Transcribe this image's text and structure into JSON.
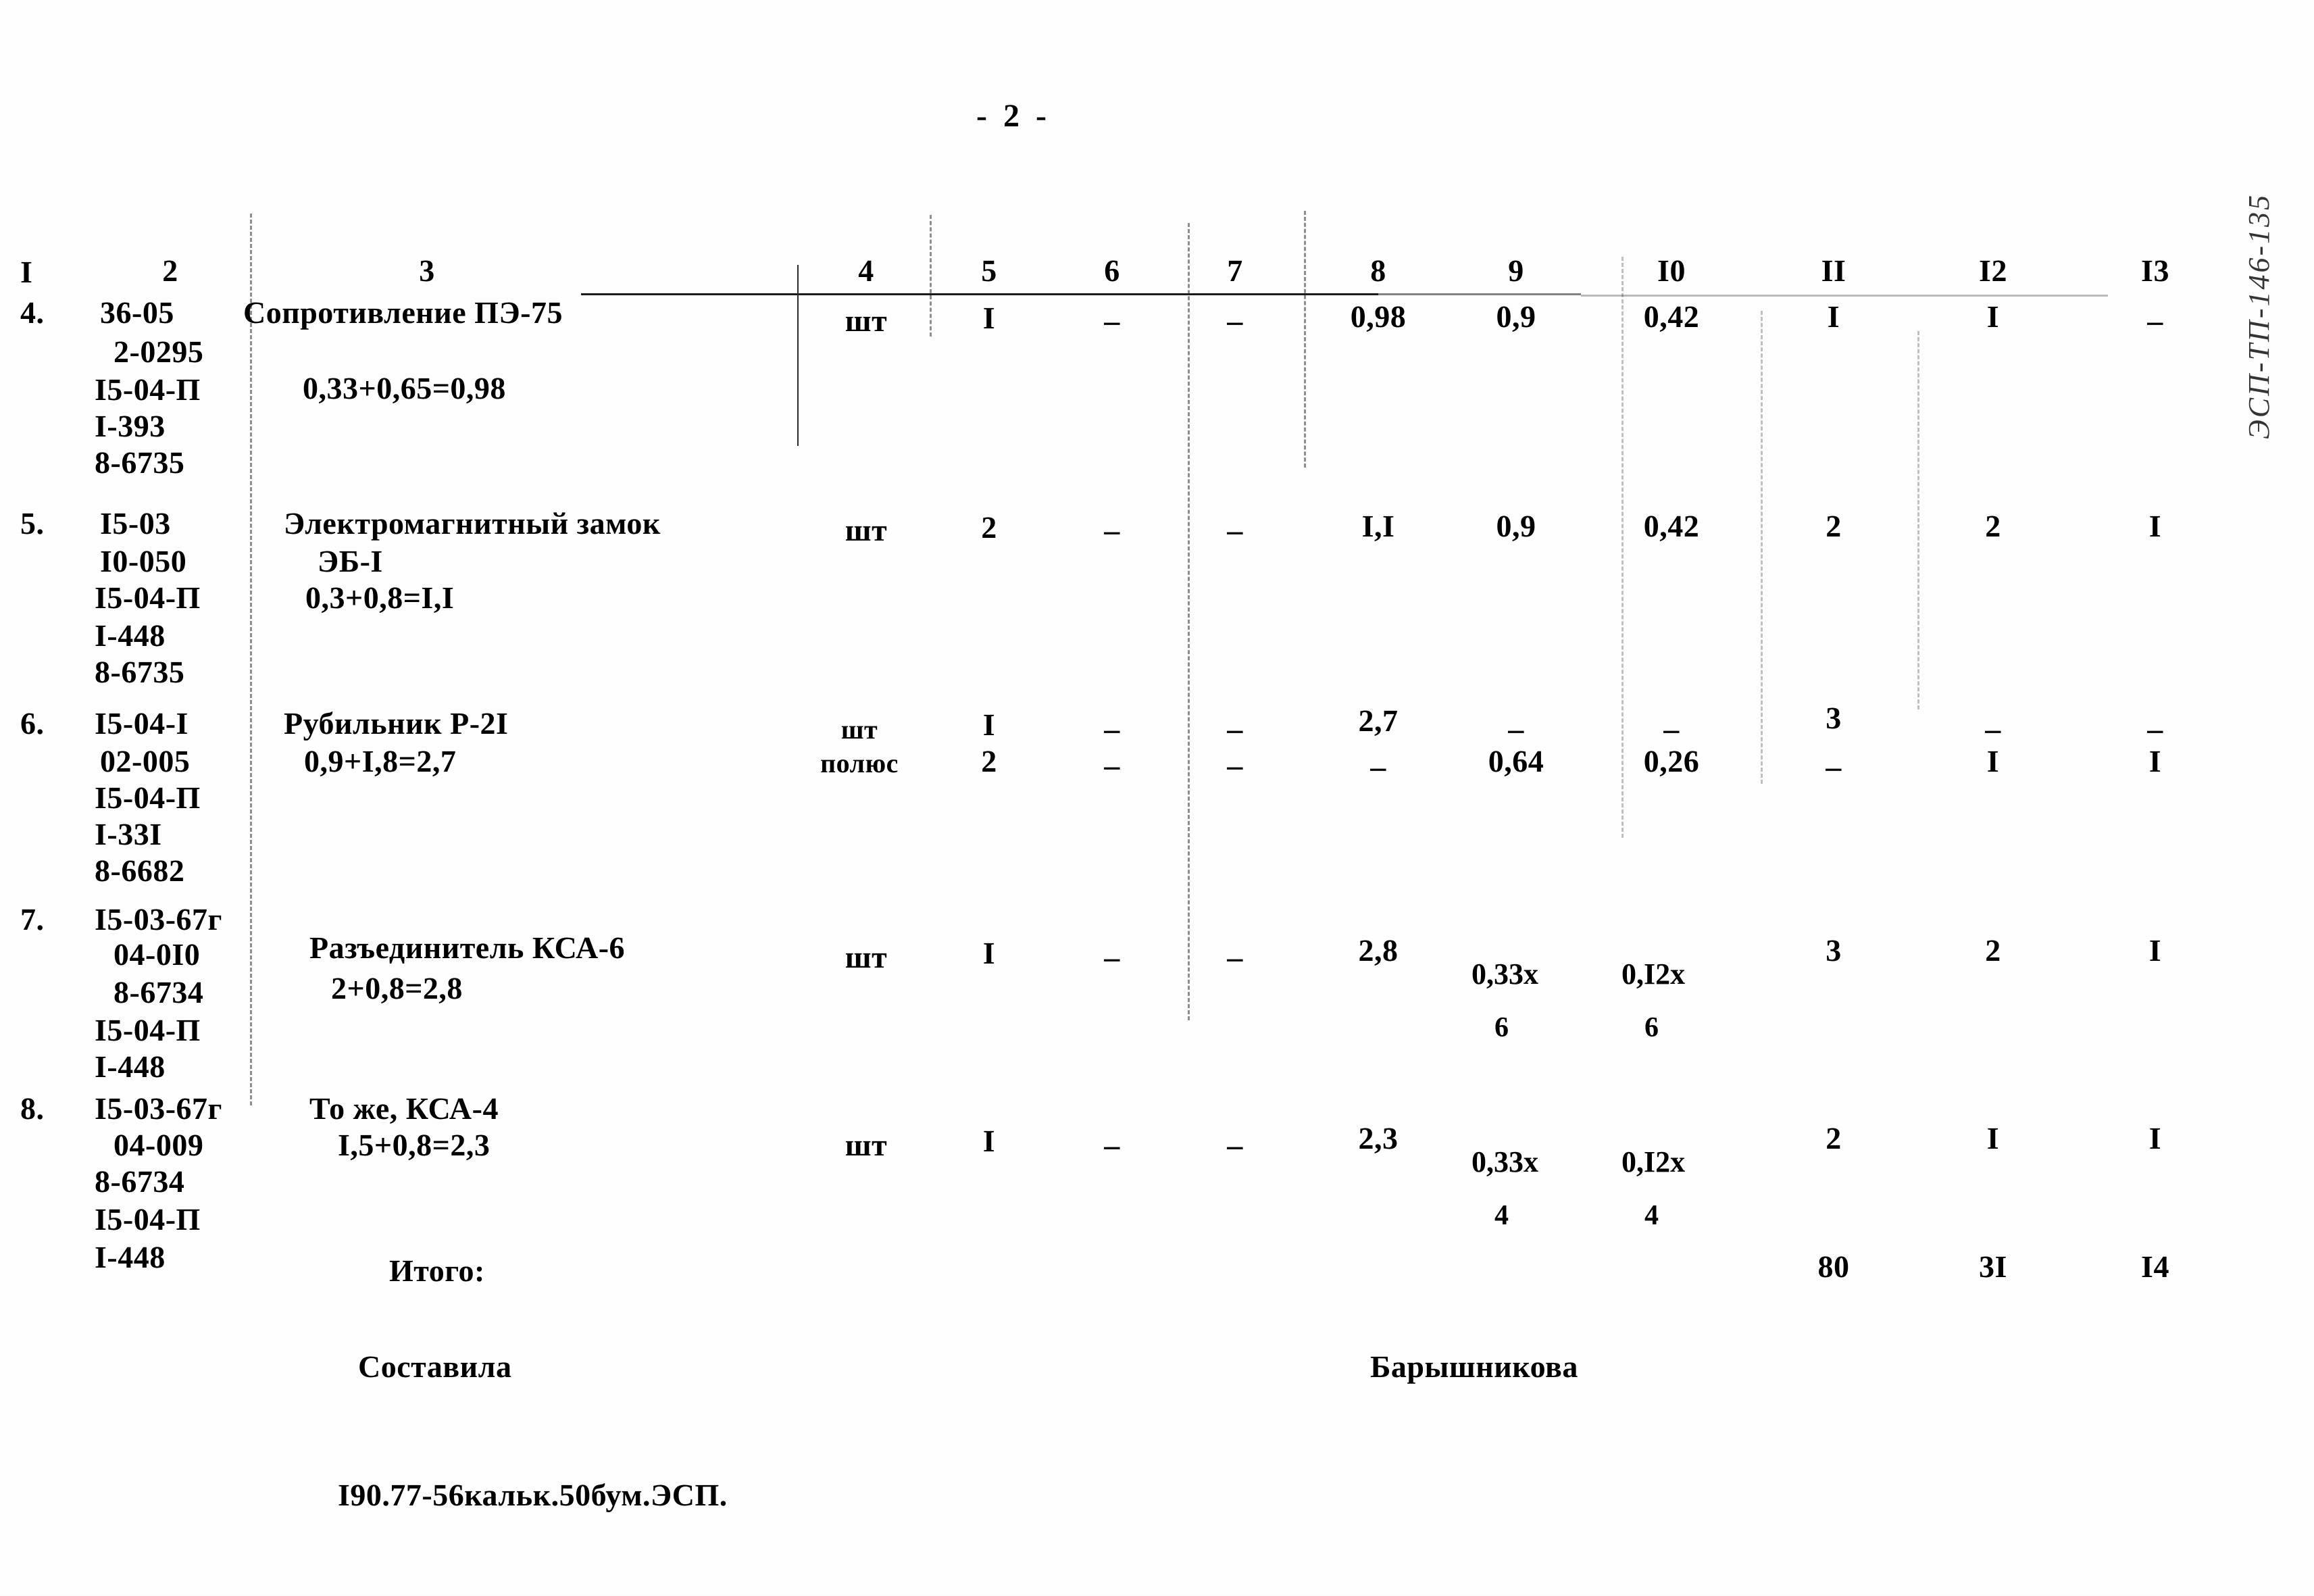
{
  "page": {
    "page_number_label": "- 2 -",
    "margin_note": "ЭСП-ТП-146-135"
  },
  "table": {
    "column_headers": [
      "I",
      "2",
      "3",
      "4",
      "5",
      "6",
      "7",
      "8",
      "9",
      "I0",
      "II",
      "I2",
      "I3"
    ],
    "rows": [
      {
        "num": "4.",
        "codes": [
          "36-05",
          "2-0295",
          "I5-04-П",
          "I-393",
          "8-6735"
        ],
        "name": "Сопротивление ПЭ-75",
        "formula": "0,33+0,65=0,98",
        "c4": "шт",
        "c5": "I",
        "c6": "–",
        "c7": "–",
        "c8": "0,98",
        "c9": "0,9",
        "c10": "0,42",
        "c11": "I",
        "c12": "I",
        "c13": "–"
      },
      {
        "num": "5.",
        "codes": [
          "I5-03",
          "I0-050",
          "I5-04-П",
          "I-448",
          "8-6735"
        ],
        "name": "Электромагнитный замок",
        "name2": "ЭБ-I",
        "formula": "0,3+0,8=I,I",
        "c4": "шт",
        "c5": "2",
        "c6": "–",
        "c7": "–",
        "c8": "I,I",
        "c9": "0,9",
        "c10": "0,42",
        "c11": "2",
        "c12": "2",
        "c13": "I"
      },
      {
        "num": "6.",
        "codes": [
          "I5-04-I",
          "02-005",
          "I5-04-П",
          "I-33I",
          "8-6682"
        ],
        "name": "Рубильник Р-2I",
        "formula": "0,9+I,8=2,7",
        "c4": "шт",
        "c4b": "полюс",
        "c5": "I",
        "c5b": "2",
        "c6": "–",
        "c6b": "–",
        "c7": "–",
        "c7b": "–",
        "c8": "2,7",
        "c8b": "–",
        "c9": "–",
        "c9b": "0,64",
        "c10": "–",
        "c10b": "0,26",
        "c11": "3",
        "c11b": "–",
        "c12": "–",
        "c12b": "I",
        "c13": "–",
        "c13b": "I"
      },
      {
        "num": "7.",
        "codes": [
          "I5-03-67г",
          "04-0I0",
          "8-6734",
          "I5-04-П",
          "I-448"
        ],
        "name": "Разъединитель КСА-6",
        "formula": "2+0,8=2,8",
        "c4": "шт",
        "c5": "I",
        "c6": "–",
        "c7": "–",
        "c8": "2,8",
        "c9": "0,33х",
        "c9_sub": "6",
        "c10": "0,I2х",
        "c10_sub": "6",
        "c11": "3",
        "c12": "2",
        "c13": "I"
      },
      {
        "num": "8.",
        "codes": [
          "I5-03-67г",
          "04-009",
          "8-6734",
          "I5-04-П",
          "I-448"
        ],
        "name": "То же, КСА-4",
        "formula": "I,5+0,8=2,3",
        "c4": "шт",
        "c5": "I",
        "c6": "–",
        "c7": "–",
        "c8": "2,3",
        "c9": "0,33х",
        "c9_sub": "4",
        "c10": "0,I2х",
        "c10_sub": "4",
        "c11": "2",
        "c12": "I",
        "c13": "I"
      }
    ],
    "total": {
      "label": "Итого:",
      "c11": "80",
      "c12": "3I",
      "c13": "I4"
    }
  },
  "signature": {
    "role": "Составила",
    "name": "Барышникова"
  },
  "footer": {
    "text": "I90.77-56кальк.50бум.ЭСП."
  }
}
